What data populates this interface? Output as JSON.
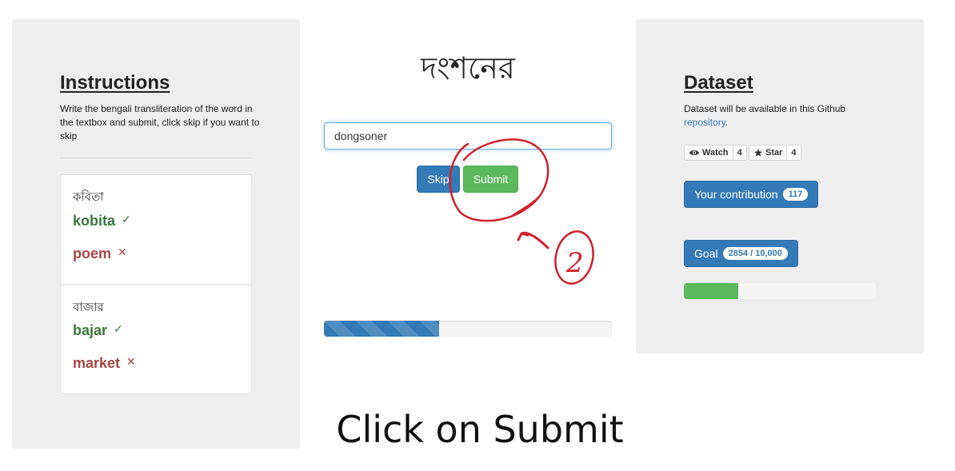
{
  "instructions": {
    "title": "Instructions",
    "text": "Write the bengali transliteration of the word in the textbox and submit, click skip if you want to skip",
    "examples": [
      {
        "bengali": "কবিতা",
        "correct": "kobita",
        "wrong": "poem"
      },
      {
        "bengali": "বাজার",
        "correct": "bajar",
        "wrong": "market"
      }
    ],
    "check_mark": "✓",
    "cross_mark": "✕"
  },
  "task": {
    "word": "দংশনের",
    "input_value": "dongsoner",
    "skip_label": "Skip",
    "submit_label": "Submit",
    "progress": 0.4
  },
  "annotation": {
    "circle_color": "#d0202a",
    "number": "2"
  },
  "caption": "Click on Submit",
  "dataset": {
    "title": "Dataset",
    "text": "Dataset will be available in this Github",
    "link_text": "repository.",
    "watch_label": "Watch",
    "watch_count": "4",
    "star_label": "Star",
    "star_count": "4",
    "contribution_label": "Your contribution",
    "contribution_count": "117",
    "goal_label": "Goal",
    "goal_value": "2854 / 10,000",
    "goal_progress": 0.2854
  },
  "colors": {
    "primary": "#337ab7",
    "success": "#5cb85c",
    "correct_text": "#3c763d",
    "wrong_text": "#a94442"
  },
  "icons": {
    "watch": "eye-icon",
    "star": "star-icon",
    "correct": "check-icon",
    "wrong": "cross-icon"
  }
}
